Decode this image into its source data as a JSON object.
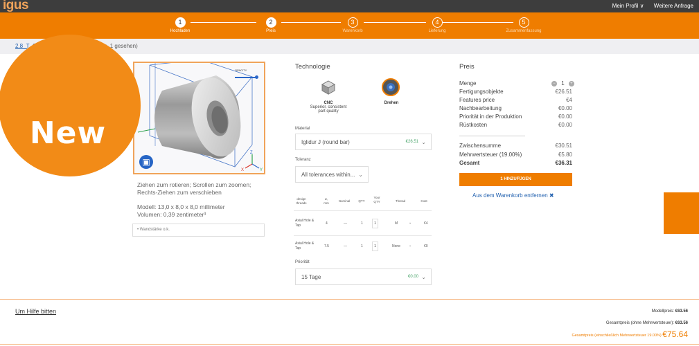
{
  "header": {
    "logo": "igus",
    "profile": "Mein Profil ∨",
    "requests": "Weitere Anfrage"
  },
  "steps": [
    {
      "num": "1",
      "label": "Hochladen"
    },
    {
      "num": "2",
      "label": "Preis"
    },
    {
      "num": "3",
      "label": "Warenkorb"
    },
    {
      "num": "4",
      "label": "Lieferung"
    },
    {
      "num": "5",
      "label": "Zusammenfassung"
    }
  ],
  "breadcrumb": {
    "link": "2.8_T_Gl",
    "rest": "(tig. 1 gesehen)"
  },
  "badge": {
    "text": "New"
  },
  "viewer": {
    "opacity_label": "OPACITY",
    "axis_z": "Z",
    "axis_x": "X",
    "axis_y": "Y"
  },
  "hint": "Ziehen zum rotieren; Scrollen zum zoomen; Rechts-Ziehen zum verschieben",
  "dims": {
    "model": "Modell: 13,0  x 8,0  x 8,0 millimeter",
    "volume": "Volumen: 0,39 zentimeter³"
  },
  "check": "•  Wandstärke o.k.",
  "technology": {
    "title": "Technologie",
    "cnc": {
      "name": "CNC",
      "desc1": "Superior, consistent",
      "desc2": "part quality"
    },
    "turning": {
      "name": "Drehen"
    }
  },
  "material": {
    "label": "Material",
    "value": "Iglidur J (round bar)",
    "price": "€26.51"
  },
  "tolerance": {
    "label": "Toleranz",
    "value": "All tolerances within..."
  },
  "features": {
    "headers": [
      "design threads",
      "ø, mm",
      "Nominal",
      "QTY",
      "Your QTY",
      "Thread",
      "Cost"
    ],
    "rows": [
      {
        "name": "Axial Hole & Tap",
        "dia": "4",
        "nominal": "—",
        "qty": "1",
        "your_qty": "1",
        "thread": "M",
        "cost": "€4"
      },
      {
        "name": "Axial Hole & Tap",
        "dia": "7.5",
        "nominal": "—",
        "qty": "1",
        "your_qty": "1",
        "thread": "None",
        "cost": "€0"
      }
    ]
  },
  "priority": {
    "label": "Priorität",
    "value": "15 Tage",
    "price": "€0.00"
  },
  "price": {
    "title": "Preis",
    "qty_label": "Menge",
    "qty": "1",
    "rows": [
      {
        "label": "Fertigungsobjekte",
        "value": "€26.51"
      },
      {
        "label": "Features price",
        "value": "€4"
      },
      {
        "label": "Nachbearbeitung",
        "value": "€0.00"
      },
      {
        "label": "Priorität in der Produktion",
        "value": "€0.00"
      },
      {
        "label": "Rüstkosten",
        "value": "€0.00"
      }
    ],
    "subtotal_label": "Zwischensumme",
    "subtotal": "€30.51",
    "vat_label": "Mehrwertsteuer (19.00%)",
    "vat": "€5.80",
    "total_label": "Gesamt",
    "total": "€36.31",
    "add_button": "1 HINZUFÜGEN",
    "remove": "Aus dem Warenkorb entfernen ✖"
  },
  "footer": {
    "help": "Um Hilfe bitten",
    "model_price_label": "Modellpreis:",
    "model_price": "€63.56",
    "net_label": "Gesamtpreis (ohne Mehrwertsteuer):",
    "net": "€63.56",
    "gross_label": "Gesamtpreis (einschließlich Mehrwertsteuer 19.00%)",
    "gross": "€75.64"
  },
  "colors": {
    "accent": "#ef7d00",
    "link": "#1f5fae",
    "viewer_blue": "#2765c5"
  }
}
